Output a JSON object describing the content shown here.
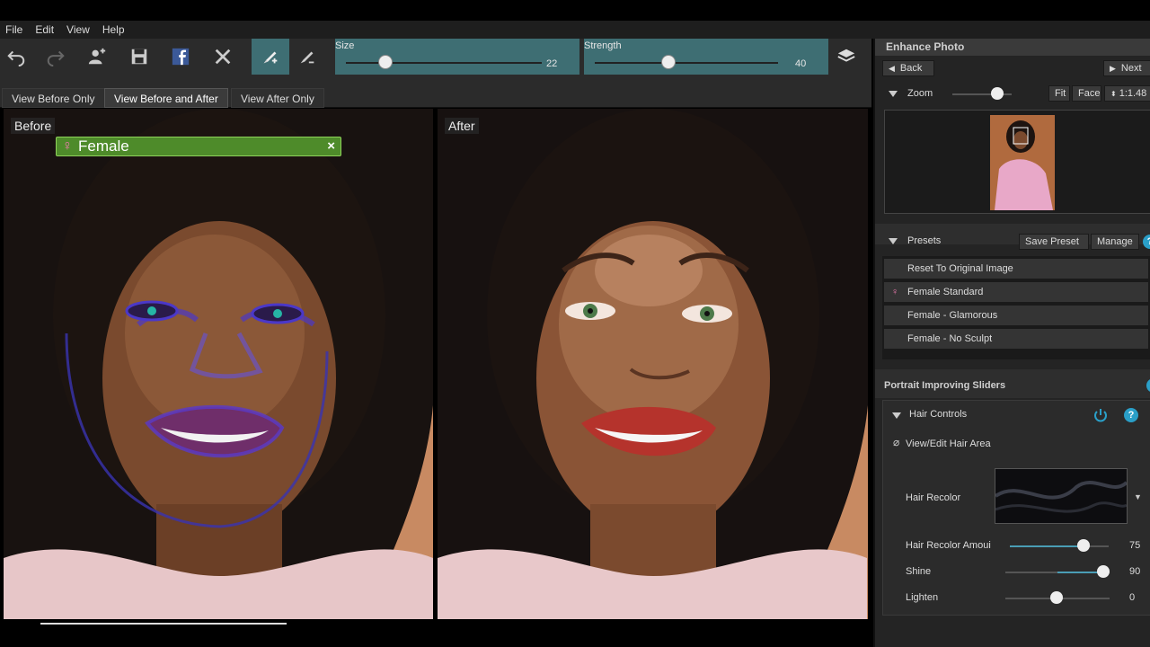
{
  "menu": [
    "File",
    "Edit",
    "View",
    "Help"
  ],
  "toolbar": {
    "size": {
      "label": "Size",
      "value": "22"
    },
    "strength": {
      "label": "Strength",
      "value": "40"
    }
  },
  "view_tabs": [
    "View Before Only",
    "View Before and After",
    "View After Only"
  ],
  "before_label": "Before",
  "after_label": "After",
  "face_tag": {
    "label": "Female",
    "close": "×"
  },
  "panel": {
    "enhance_title": "Enhance Photo",
    "back": "Back",
    "next": "Next",
    "zoom_label": "Zoom",
    "fit": "Fit",
    "face": "Face",
    "ratio": "1:1.48",
    "presets_label": "Presets",
    "save_preset": "Save Preset",
    "manage": "Manage",
    "presets": [
      "Reset To Original Image",
      "Female Standard",
      "Female - Glamorous",
      "Female - No Sculpt"
    ],
    "sliders_title": "Portrait Improving Sliders",
    "hair_controls": "Hair Controls",
    "view_edit_hair": "View/Edit Hair Area",
    "hair_recolor": "Hair Recolor",
    "sliders": [
      {
        "label": "Hair Recolor Amoui",
        "value": "75",
        "fraction": 0.75
      },
      {
        "label": "Shine",
        "value": "90",
        "fraction": 0.93
      },
      {
        "label": "Lighten",
        "value": "0",
        "fraction": 0.5
      }
    ]
  },
  "colors": {
    "accent": "#3e6e73",
    "tag_green": "#4e8b2a",
    "help_blue": "#2a9fc8"
  }
}
